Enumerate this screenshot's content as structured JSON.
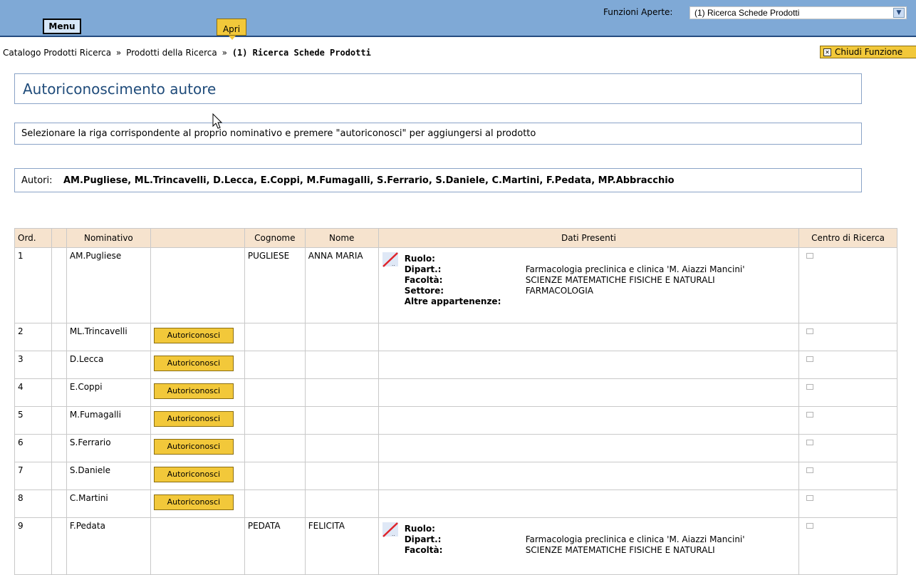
{
  "topbar": {
    "menu_label": "Menu",
    "apri_label": "Apri",
    "funzioni_label": "Funzioni Aperte:",
    "funzioni_selected": "(1) Ricerca Schede Prodotti"
  },
  "breadcrumb": {
    "items": [
      "Catalogo Prodotti Ricerca",
      "Prodotti della Ricerca"
    ],
    "separator": "»",
    "current": "(1) Ricerca Schede Prodotti"
  },
  "chiudi_label": "Chiudi Funzione",
  "page_title": "Autoriconoscimento autore",
  "instructions": "Selezionare la riga corrispondente al proprio nominativo e premere \"autoriconosci\" per aggiungersi al prodotto",
  "autori": {
    "label": "Autori:",
    "list": "AM.Pugliese, ML.Trincavelli, D.Lecca, E.Coppi, M.Fumagalli, S.Ferrario, S.Daniele, C.Martini, F.Pedata, MP.Abbracchio"
  },
  "table": {
    "headers": {
      "ord": "Ord.",
      "nominativo": "Nominativo",
      "action": "",
      "cognome": "Cognome",
      "nome": "Nome",
      "dati": "Dati Presenti",
      "centro": "Centro di Ricerca"
    },
    "button_label": "Autoriconosci",
    "dati_keys": {
      "ruolo": "Ruolo:",
      "dipart": "Dipart.:",
      "facolta": "Facoltà:",
      "settore": "Settore:",
      "altre": "Altre appartenenze:"
    },
    "rows": [
      {
        "ord": "1",
        "nominativo": "AM.Pugliese",
        "cognome": "PUGLIESE",
        "nome": "ANNA MARIA",
        "ruolo": "",
        "dipart": "Farmacologia preclinica e clinica 'M. Aiazzi Mancini'",
        "facolta": "SCIENZE MATEMATICHE FISICHE E NATURALI",
        "settore": "FARMACOLOGIA",
        "altre": ""
      },
      {
        "ord": "2",
        "nominativo": "ML.Trincavelli"
      },
      {
        "ord": "3",
        "nominativo": "D.Lecca"
      },
      {
        "ord": "4",
        "nominativo": "E.Coppi"
      },
      {
        "ord": "5",
        "nominativo": "M.Fumagalli"
      },
      {
        "ord": "6",
        "nominativo": "S.Ferrario"
      },
      {
        "ord": "7",
        "nominativo": "S.Daniele"
      },
      {
        "ord": "8",
        "nominativo": "C.Martini"
      },
      {
        "ord": "9",
        "nominativo": "F.Pedata",
        "cognome": "PEDATA",
        "nome": "FELICITA",
        "ruolo": "",
        "dipart": "Farmacologia preclinica e clinica 'M. Aiazzi Mancini'",
        "facolta": "SCIENZE MATEMATICHE FISICHE E NATURALI"
      }
    ]
  },
  "colors": {
    "topbar_bg": "#7fa9d6",
    "button_yellow": "#f2c83a",
    "header_bg": "#f6e3ce",
    "title_blue": "#1f4b7a"
  },
  "icons": [
    "chevron-down-icon",
    "close-box-icon",
    "edit-pencil-icon",
    "checkbox-icon",
    "mouse-cursor-icon"
  ]
}
